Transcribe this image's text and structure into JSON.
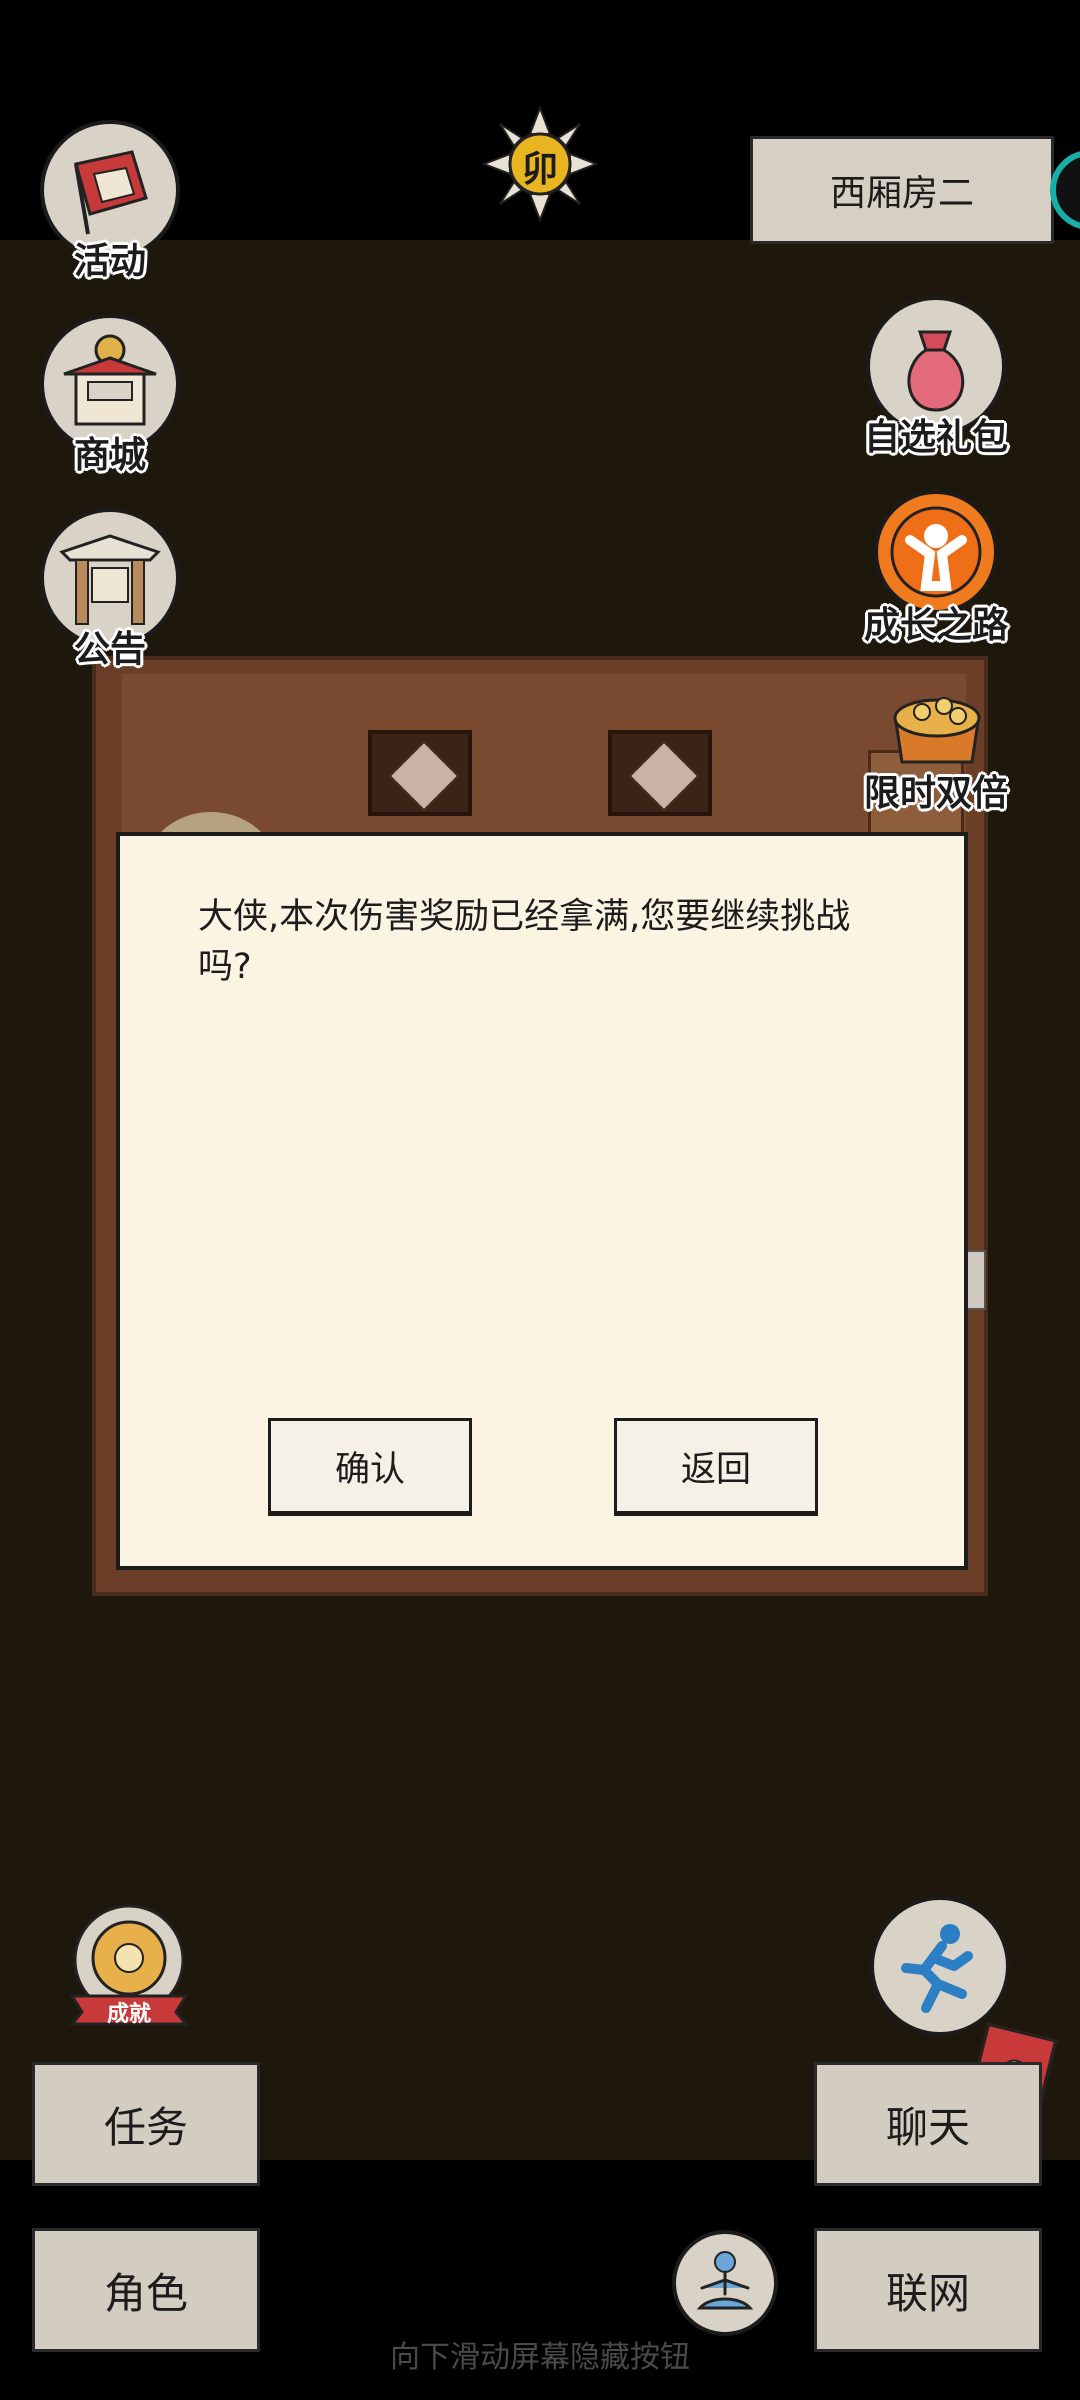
{
  "location": {
    "name": "西厢房二"
  },
  "left_menu": [
    {
      "label": "活动"
    },
    {
      "label": "商城"
    },
    {
      "label": "公告"
    }
  ],
  "right_menu": [
    {
      "label": "自选礼包"
    },
    {
      "label": "成长之路"
    },
    {
      "label": "限时双倍"
    }
  ],
  "top_emblem": {
    "text": "卯"
  },
  "dialog": {
    "message": "大侠,本次伤害奖励已经拿满,您要继续挑战吗?",
    "confirm_label": "确认",
    "back_label": "返回"
  },
  "achievement_badge": {
    "label": "成就"
  },
  "bottom_left": {
    "task_label": "任务",
    "role_label": "角色"
  },
  "bottom_right": {
    "chat_label": "聊天",
    "network_label": "联网"
  },
  "system_hint": "向下滑动屏幕隐藏按钮",
  "colors": {
    "background": "#1e170c",
    "dialog": "#fbf4e3",
    "accent_teal": "#17b0a8",
    "red": "#c8393a"
  }
}
